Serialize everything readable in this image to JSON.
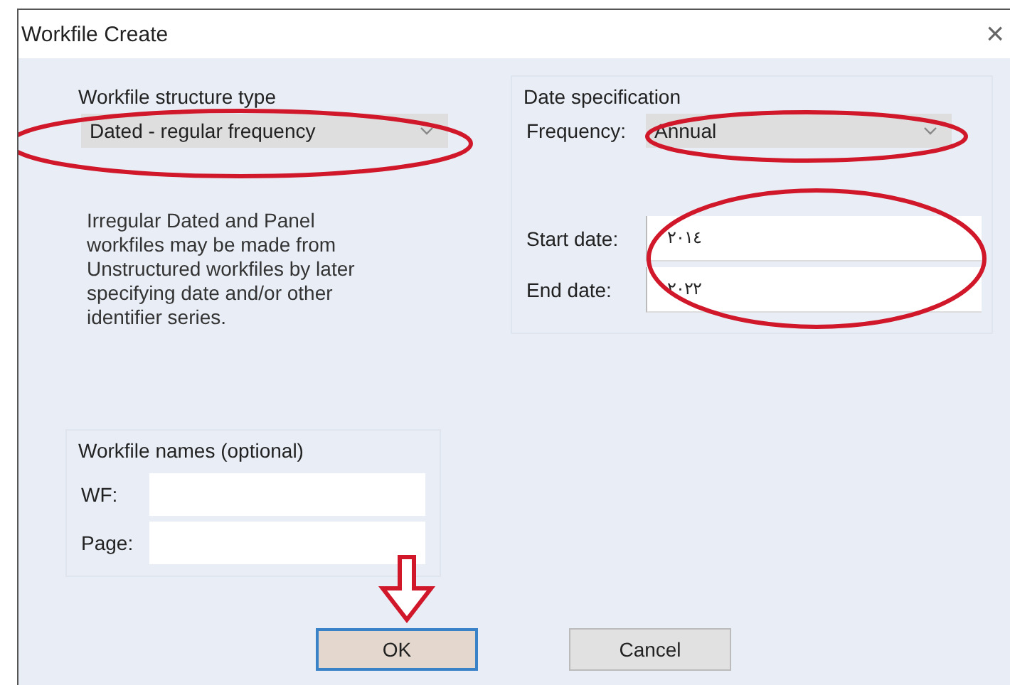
{
  "window": {
    "title": "Workfile Create",
    "close": "×"
  },
  "structure": {
    "label": "Workfile structure type",
    "value": "Dated - regular frequency",
    "note": "Irregular Dated and Panel workfiles may be made from Unstructured workfiles by later specifying date and/or other identifier series."
  },
  "date_spec": {
    "label": "Date specification",
    "frequency_label": "Frequency:",
    "frequency": "Annual",
    "start_label": "Start date:",
    "start": "٢٠١٤",
    "end_label": "End date:",
    "end": "٢٠٢٢"
  },
  "names": {
    "label": "Workfile names (optional)",
    "wf_label": "WF:",
    "page_label": "Page:"
  },
  "buttons": [
    {
      "label": "OK",
      "selected": true
    },
    {
      "label": "Cancel",
      "selected": false
    }
  ]
}
